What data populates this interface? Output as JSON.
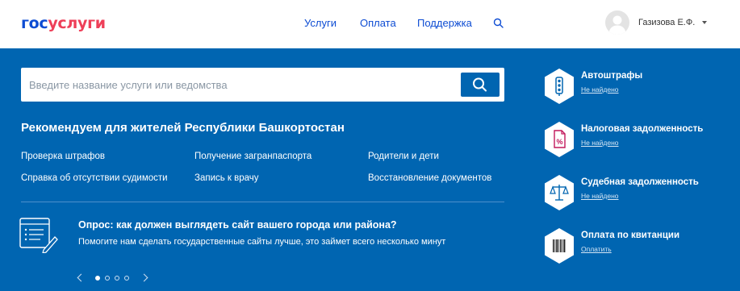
{
  "header": {
    "logo_part1": "гос",
    "logo_part2": "услуги",
    "nav": [
      {
        "label": "Услуги"
      },
      {
        "label": "Оплата"
      },
      {
        "label": "Поддержка"
      }
    ],
    "search_icon": "search-icon",
    "user": {
      "name": "Газизова Е.Ф.",
      "avatar": "avatar"
    }
  },
  "search": {
    "placeholder": "Введите название услуги или ведомства",
    "value": ""
  },
  "recommend": {
    "title": "Рекомендуем для жителей Республики Башкортостан",
    "links": [
      "Проверка штрафов",
      "Получение загранпаспорта",
      "Родители и дети",
      "Справка об отсутствии судимости",
      "Запись к врачу",
      "Восстановление документов"
    ]
  },
  "survey": {
    "title": "Опрос: как должен выглядеть сайт вашего города или района?",
    "text": "Помогите нам сделать государственные сайты лучше, это займет всего несколько минут",
    "carousel": {
      "total_pages": 4,
      "active_page": 1
    }
  },
  "sidebar": {
    "items": [
      {
        "title": "Автоштрафы",
        "status": "Не найдено",
        "icon": "traffic-light-icon"
      },
      {
        "title": "Налоговая задолженность",
        "status": "Не найдено",
        "icon": "tax-document-icon"
      },
      {
        "title": "Судебная задолженность",
        "status": "Не найдено",
        "icon": "scales-icon"
      },
      {
        "title": "Оплата по квитанции",
        "status": "Оплатить",
        "icon": "barcode-icon"
      }
    ]
  },
  "colors": {
    "primary_blue": "#0065b1",
    "logo_blue": "#0d4cd3",
    "logo_red": "#ee3f58",
    "white": "#ffffff"
  }
}
